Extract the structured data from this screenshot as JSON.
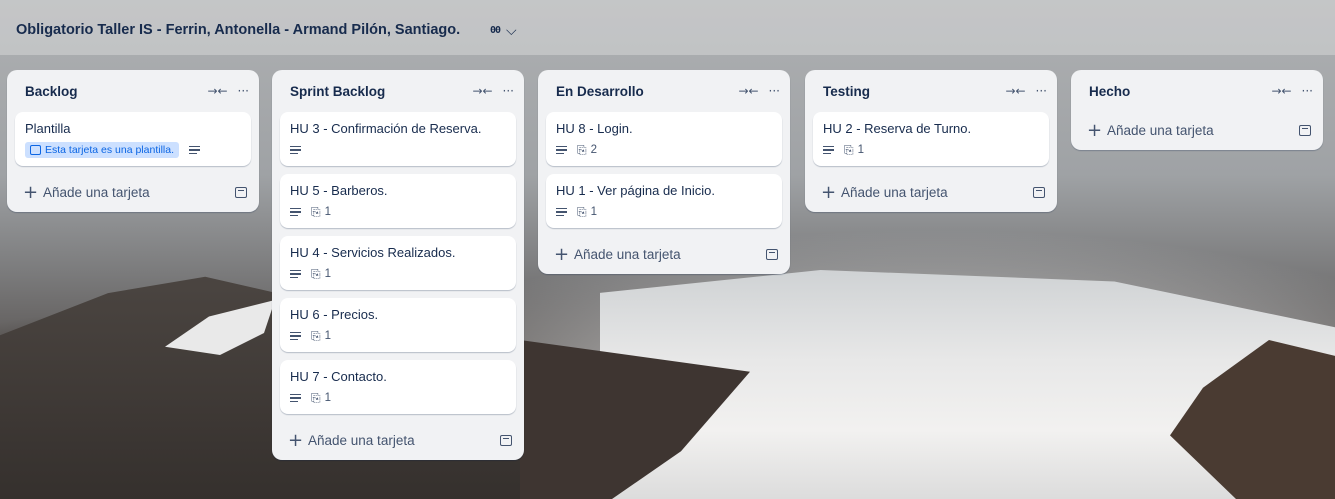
{
  "board": {
    "title": "Obligatorio Taller IS - Ferrin, Antonella - Armand Pilón, Santiago.",
    "view_glyph": "00",
    "chevron": "⌵"
  },
  "icons": {
    "collapse": "→←",
    "more": "···",
    "plus": "+",
    "attachment": "🔗"
  },
  "lists": [
    {
      "title": "Backlog",
      "cards": [
        {
          "title": "Plantilla",
          "template_badge": "Esta tarjeta es una plantilla.",
          "has_description": true
        }
      ],
      "add_label": "Añade una tarjeta"
    },
    {
      "title": "Sprint Backlog",
      "cards": [
        {
          "title": "HU 3 - Confirmación de Reserva.",
          "has_description": true
        },
        {
          "title": "HU 5 - Barberos.",
          "has_description": true,
          "attachments": "1"
        },
        {
          "title": "HU 4 - Servicios Realizados.",
          "has_description": true,
          "attachments": "1"
        },
        {
          "title": "HU 6 - Precios.",
          "has_description": true,
          "attachments": "1"
        },
        {
          "title": "HU 7 - Contacto.",
          "has_description": true,
          "attachments": "1"
        }
      ],
      "add_label": "Añade una tarjeta"
    },
    {
      "title": "En Desarrollo",
      "cards": [
        {
          "title": "HU 8 - Login.",
          "has_description": true,
          "attachments": "2"
        },
        {
          "title": "HU 1 - Ver página de Inicio.",
          "has_description": true,
          "attachments": "1"
        }
      ],
      "add_label": "Añade una tarjeta"
    },
    {
      "title": "Testing",
      "cards": [
        {
          "title": "HU 2 - Reserva de Turno.",
          "has_description": true,
          "attachments": "1"
        }
      ],
      "add_label": "Añade una tarjeta"
    },
    {
      "title": "Hecho",
      "cards": [],
      "add_label": "Añade una tarjeta"
    }
  ]
}
